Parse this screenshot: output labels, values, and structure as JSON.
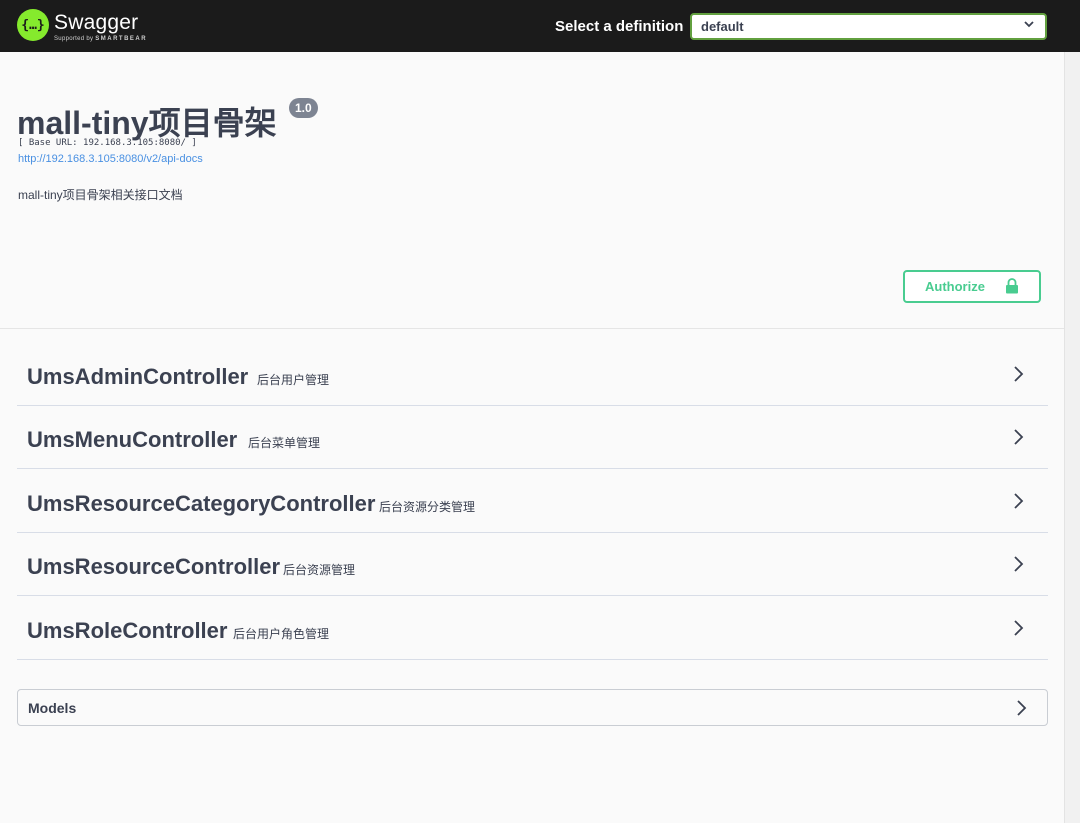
{
  "header": {
    "brand": "Swagger",
    "brand_sub_prefix": "Supported by",
    "brand_sub_name": "SMARTBEAR",
    "logo_glyph": "{…}",
    "select_label": "Select a definition",
    "select_value": "default"
  },
  "info": {
    "title": "mall-tiny项目骨架",
    "version": "1.0",
    "base_url": "[ Base URL: 192.168.3.105:8080/ ]",
    "api_docs_link": "http://192.168.3.105:8080/v2/api-docs",
    "description": "mall-tiny项目骨架相关接口文档"
  },
  "authorize": {
    "label": "Authorize"
  },
  "tags": [
    {
      "name": "UmsAdminController",
      "description": "后台用户管理"
    },
    {
      "name": "UmsMenuController",
      "description": "后台菜单管理"
    },
    {
      "name": "UmsResourceCategoryController",
      "description": "后台资源分类管理"
    },
    {
      "name": "UmsResourceController",
      "description": "后台资源管理"
    },
    {
      "name": "UmsRoleController",
      "description": "后台用户角色管理"
    }
  ],
  "models": {
    "label": "Models"
  },
  "colors": {
    "topbar": "#1b1b1b",
    "logo_green": "#85ea2d",
    "authorize_green": "#49cc90",
    "link_blue": "#4990e2",
    "select_border": "#62a03f"
  }
}
